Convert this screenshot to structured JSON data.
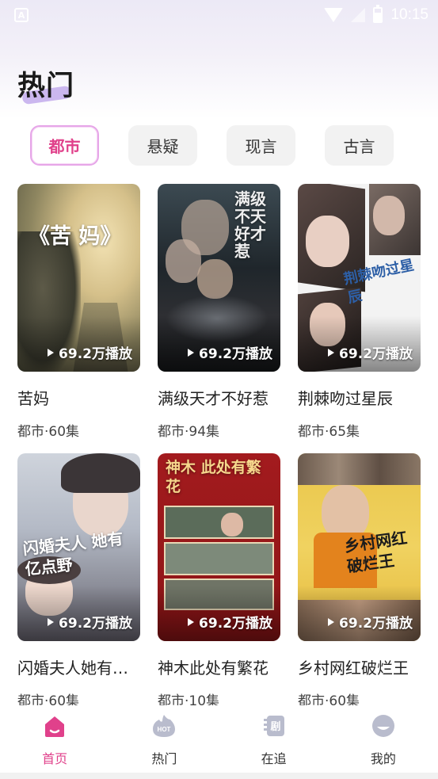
{
  "status_bar": {
    "time": "10:15",
    "app_icon": "A"
  },
  "page": {
    "title": "热门"
  },
  "tabs": [
    {
      "label": "都市",
      "active": true
    },
    {
      "label": "悬疑",
      "active": false
    },
    {
      "label": "现言",
      "active": false
    },
    {
      "label": "古言",
      "active": false
    }
  ],
  "dramas": [
    {
      "title": "苦妈",
      "meta": "都市·60集",
      "plays": "69.2万播放",
      "poster_text": "《苦 妈》"
    },
    {
      "title": "满级天才不好惹",
      "meta": "都市·94集",
      "plays": "69.2万播放",
      "poster_text": "满级不天好才惹"
    },
    {
      "title": "荆棘吻过星辰",
      "meta": "都市·65集",
      "plays": "69.2万播放",
      "poster_text": "荆棘吻过星辰"
    },
    {
      "title": "闪婚夫人她有亿点野",
      "meta": "都市·60集",
      "plays": "69.2万播放",
      "poster_text": "闪婚夫人 她有亿点野"
    },
    {
      "title": "神木此处有繁花",
      "meta": "都市·10集",
      "plays": "69.2万播放",
      "poster_text": "神木 此处有繁花"
    },
    {
      "title": "乡村网红破烂王",
      "meta": "都市·60集",
      "plays": "69.2万播放",
      "poster_text": "乡村网红 破烂王"
    }
  ],
  "nav": [
    {
      "label": "首页",
      "icon": "home-icon",
      "active": true
    },
    {
      "label": "热门",
      "icon": "hot-icon",
      "active": false
    },
    {
      "label": "在追",
      "icon": "drama-icon",
      "active": false
    },
    {
      "label": "我的",
      "icon": "profile-icon",
      "active": false
    }
  ],
  "colors": {
    "accent": "#e0418b",
    "tab_border": "#e6a6e8",
    "title_highlight": "#cbb7ef"
  }
}
